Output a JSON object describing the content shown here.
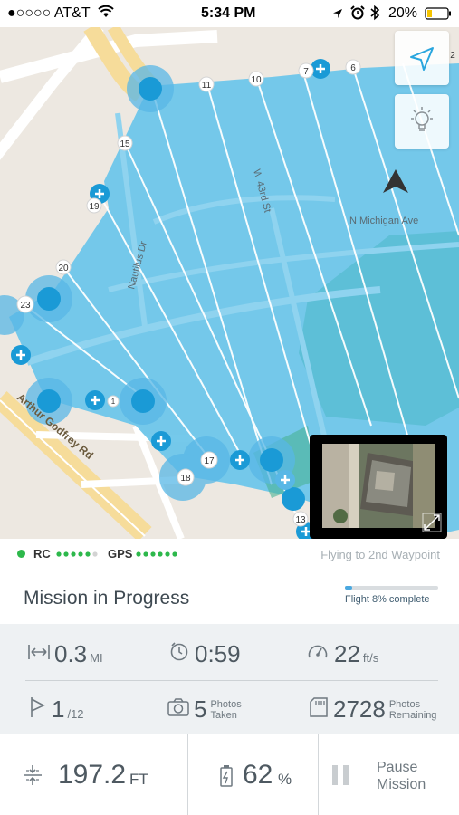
{
  "status_bar": {
    "carrier": "●○○○○ AT&T",
    "time": "5:34 PM",
    "battery": "20%"
  },
  "map": {
    "street_labels": [
      "Nautilus Dr",
      "W 43rd St",
      "N Michigan Ave",
      "Arthur Godfrey Rd"
    ],
    "waypoint_numbers": [
      "2",
      "6",
      "7",
      "10",
      "11",
      "13",
      "15",
      "17",
      "18",
      "19",
      "20",
      "23",
      "1"
    ],
    "locate_button_icon": "navigation-arrow-icon",
    "lightbulb_button_icon": "lightbulb-icon"
  },
  "connection": {
    "rc_label": "RC",
    "gps_label": "GPS",
    "status_text": "Flying to 2nd Waypoint"
  },
  "mission": {
    "title": "Mission in Progress",
    "progress_text": "Flight 8% complete",
    "progress_fraction": 0.08
  },
  "stats": {
    "distance": {
      "value": "0.3",
      "unit": "MI",
      "icon": "distance-icon"
    },
    "time": {
      "value": "0:59",
      "icon": "timer-icon"
    },
    "speed": {
      "value": "22",
      "unit": "ft/s",
      "icon": "speedometer-icon"
    },
    "waypoint": {
      "value": "1",
      "unit": "/12",
      "icon": "flag-icon"
    },
    "photos_taken": {
      "value": "5",
      "label_line1": "Photos",
      "label_line2": "Taken",
      "icon": "camera-icon"
    },
    "photos_remaining": {
      "value": "2728",
      "label_line1": "Photos",
      "label_line2": "Remaining",
      "icon": "sd-card-icon"
    }
  },
  "bottom_bar": {
    "altitude": {
      "value": "197.2",
      "unit": "FT"
    },
    "battery": {
      "value": "62",
      "unit": "%"
    },
    "pause_line1": "Pause",
    "pause_line2": "Mission"
  },
  "colors": {
    "area_fill": "#6ec6ea",
    "waypoint_blue": "#1a9ad6",
    "progress_blue": "#4aa8e0",
    "green_dot": "#2db84b"
  }
}
